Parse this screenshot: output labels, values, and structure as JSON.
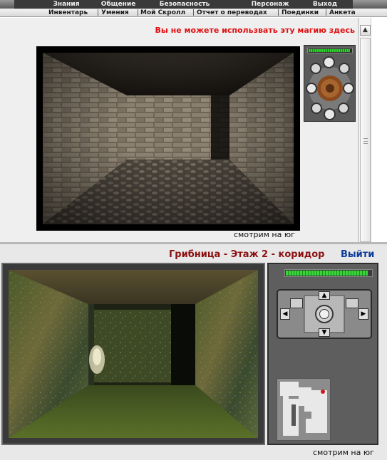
{
  "top_menu": {
    "items": [
      "Знания",
      "Общение",
      "Безопасность",
      "Персонаж",
      "Выход"
    ]
  },
  "sub_menu": {
    "items": [
      "Инвентарь",
      "Умения",
      "Мой Скролл",
      "Отчет о переводах",
      "Поединки",
      "Анкета"
    ]
  },
  "upper": {
    "warning": "Вы не можете использвать эту магию здесь",
    "view_caption": "смотрим на юг",
    "hp_fraction": 0.97
  },
  "lower": {
    "location": "Грибница - Этаж 2 - коридор",
    "exit_label": "Выйти",
    "view_caption": "смотрим на юг",
    "hp_fraction": 0.96
  },
  "colors": {
    "warning": "#e01010",
    "location": "#8a1010",
    "exit_link": "#0c3c9a",
    "hp_green": "#33cc33"
  }
}
